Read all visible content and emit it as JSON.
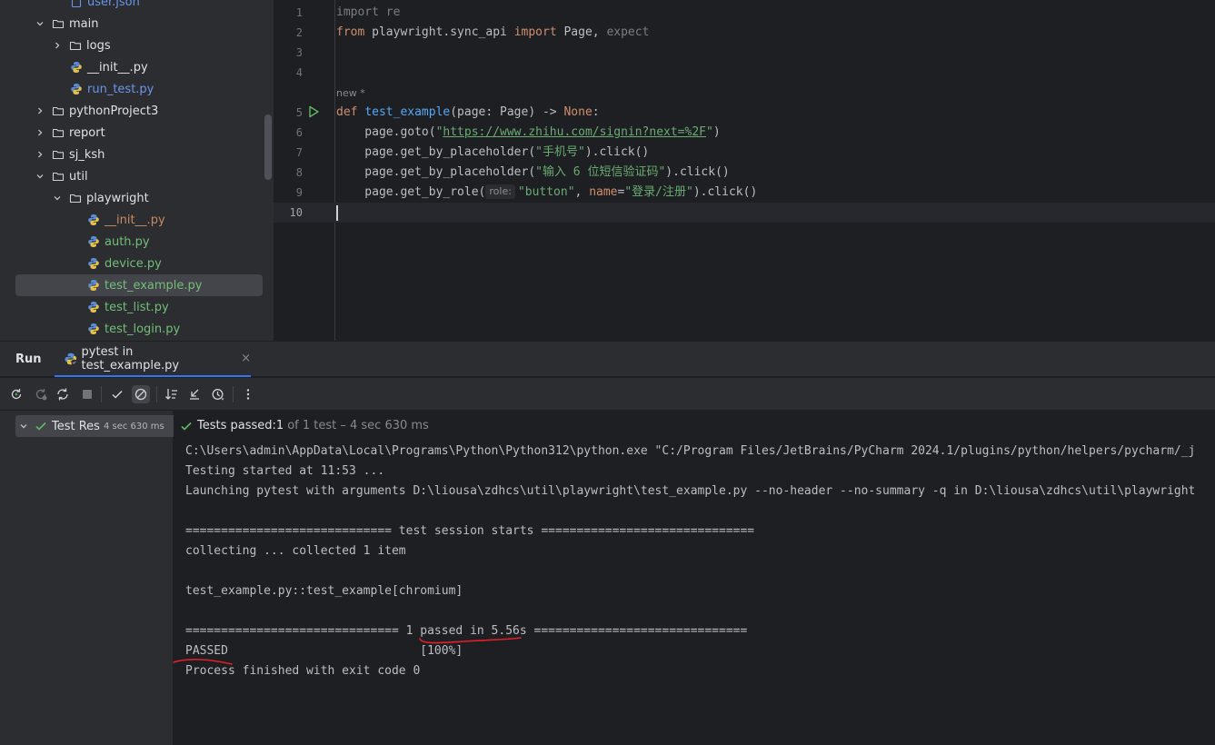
{
  "project_tree": {
    "items": [
      {
        "label": "user.json",
        "type": "file-json",
        "indent": 3,
        "color": "blue",
        "partial": true
      },
      {
        "label": "main",
        "type": "dir",
        "indent": 2,
        "expanded": true
      },
      {
        "label": "logs",
        "type": "dir",
        "indent": 3,
        "expanded": false
      },
      {
        "label": "__init__.py",
        "type": "py",
        "indent": 4,
        "color": "default"
      },
      {
        "label": "run_test.py",
        "type": "py",
        "indent": 4,
        "color": "blue"
      },
      {
        "label": "pythonProject3",
        "type": "dir",
        "indent": 2,
        "expanded": false
      },
      {
        "label": "report",
        "type": "dir",
        "indent": 2,
        "expanded": false
      },
      {
        "label": "sj_ksh",
        "type": "dir",
        "indent": 2,
        "expanded": false
      },
      {
        "label": "util",
        "type": "dir",
        "indent": 2,
        "expanded": true
      },
      {
        "label": "playwright",
        "type": "dir",
        "indent": 3,
        "expanded": true
      },
      {
        "label": "__init__.py",
        "type": "py",
        "indent": 5,
        "color": "orange"
      },
      {
        "label": "auth.py",
        "type": "py",
        "indent": 5,
        "color": "green"
      },
      {
        "label": "device.py",
        "type": "py",
        "indent": 5,
        "color": "green"
      },
      {
        "label": "test_example.py",
        "type": "py",
        "indent": 5,
        "color": "green",
        "selected": true
      },
      {
        "label": "test_list.py",
        "type": "py",
        "indent": 5,
        "color": "green"
      },
      {
        "label": "test_login.py",
        "type": "py",
        "indent": 5,
        "color": "green"
      }
    ]
  },
  "editor": {
    "line_numbers": [
      "1",
      "2",
      "3",
      "4",
      "5",
      "6",
      "7",
      "8",
      "9",
      "10"
    ],
    "inlay_new": "new *",
    "code": {
      "l1": {
        "kw": "import",
        "rest": " re"
      },
      "l2": {
        "kw1": "from",
        "mod": " playwright.sync_api ",
        "kw2": "import",
        "names": " Page, ",
        "unused": "expect"
      },
      "l5": {
        "kw": "def",
        "fn": "test_example",
        "sig": "(page: Page) -> ",
        "ret": "None",
        "colon": ":"
      },
      "l6": {
        "pre": "    page.goto(",
        "q1": "\"",
        "url": "https://www.zhihu.com/signin?next=%2F",
        "q2": "\"",
        "post": ")"
      },
      "l7": {
        "pre": "    page.get_by_placeholder(",
        "str": "\"手机号\"",
        "post": ").click()"
      },
      "l8": {
        "pre": "    page.get_by_placeholder(",
        "str": "\"输入 6 位短信验证码\"",
        "post": ").click()"
      },
      "l9": {
        "pre": "    page.get_by_role(",
        "hint": "role:",
        "str1": "\"button\"",
        "mid": ", ",
        "param": "name",
        "eq": "=",
        "str2": "\"登录/注册\"",
        "post": ").click()"
      }
    }
  },
  "run_panel": {
    "title": "Run",
    "tab_label": "pytest in test_example.py",
    "tab_close": "×",
    "test_tree": {
      "label": "Test Res",
      "duration": "4 sec 630 ms"
    },
    "status": {
      "prefix": "Tests passed: ",
      "count": "1",
      "detail": "of 1 test – 4 sec 630 ms"
    },
    "console_lines": [
      "C:\\Users\\admin\\AppData\\Local\\Programs\\Python\\Python312\\python.exe \"C:/Program Files/JetBrains/PyCharm 2024.1/plugins/python/helpers/pycharm/_j",
      "Testing started at 11:53 ...",
      "Launching pytest with arguments D:\\liousa\\zdhcs\\util\\playwright\\test_example.py --no-header --no-summary -q in D:\\liousa\\zdhcs\\util\\playwright",
      "",
      "============================= test session starts ==============================",
      "collecting ... collected 1 item",
      "",
      "test_example.py::test_example[chromium]",
      "",
      "============================== 1 passed in 5.56s ==============================",
      "PASSED                           [100%]",
      "Process finished with exit code 0"
    ]
  },
  "colors": {
    "accent": "#3574f0",
    "pass_green": "#5fb865",
    "annotation_red": "#e0202a"
  }
}
